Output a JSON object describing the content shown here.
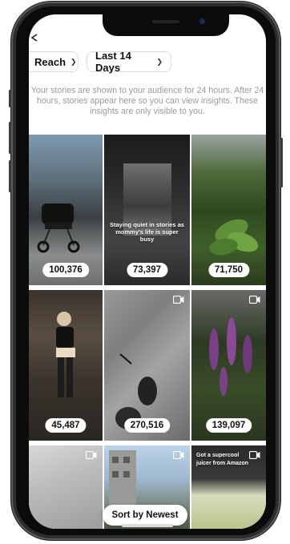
{
  "filters": {
    "metric": "Reach",
    "period": "Last 14 Days"
  },
  "info_text": "Your stories are shown to your audience for 24 hours. After 24 hours, stories appear here so you can view insights. These insights are only visible to you.",
  "stories": [
    {
      "reach": "100,376",
      "caption": "",
      "video": false
    },
    {
      "reach": "73,397",
      "caption": "Staying quiet in stories as mommy's life is super busy",
      "video": false
    },
    {
      "reach": "71,750",
      "caption": "",
      "video": false
    },
    {
      "reach": "45,487",
      "caption": "",
      "video": false
    },
    {
      "reach": "270,516",
      "caption": "",
      "video": true
    },
    {
      "reach": "139,097",
      "caption": "",
      "video": true
    },
    {
      "reach": "",
      "caption": "",
      "video": true
    },
    {
      "reach": "",
      "caption": "",
      "video": true
    },
    {
      "reach": "",
      "caption": "Got a supercool juicer from Amazon",
      "video": true
    }
  ],
  "sort_button": "Sort by Newest",
  "colors": {
    "phone_frame": "#2d2d2f",
    "count_badge_bg": "#ffffff",
    "info_text": "#9a9a9a"
  }
}
